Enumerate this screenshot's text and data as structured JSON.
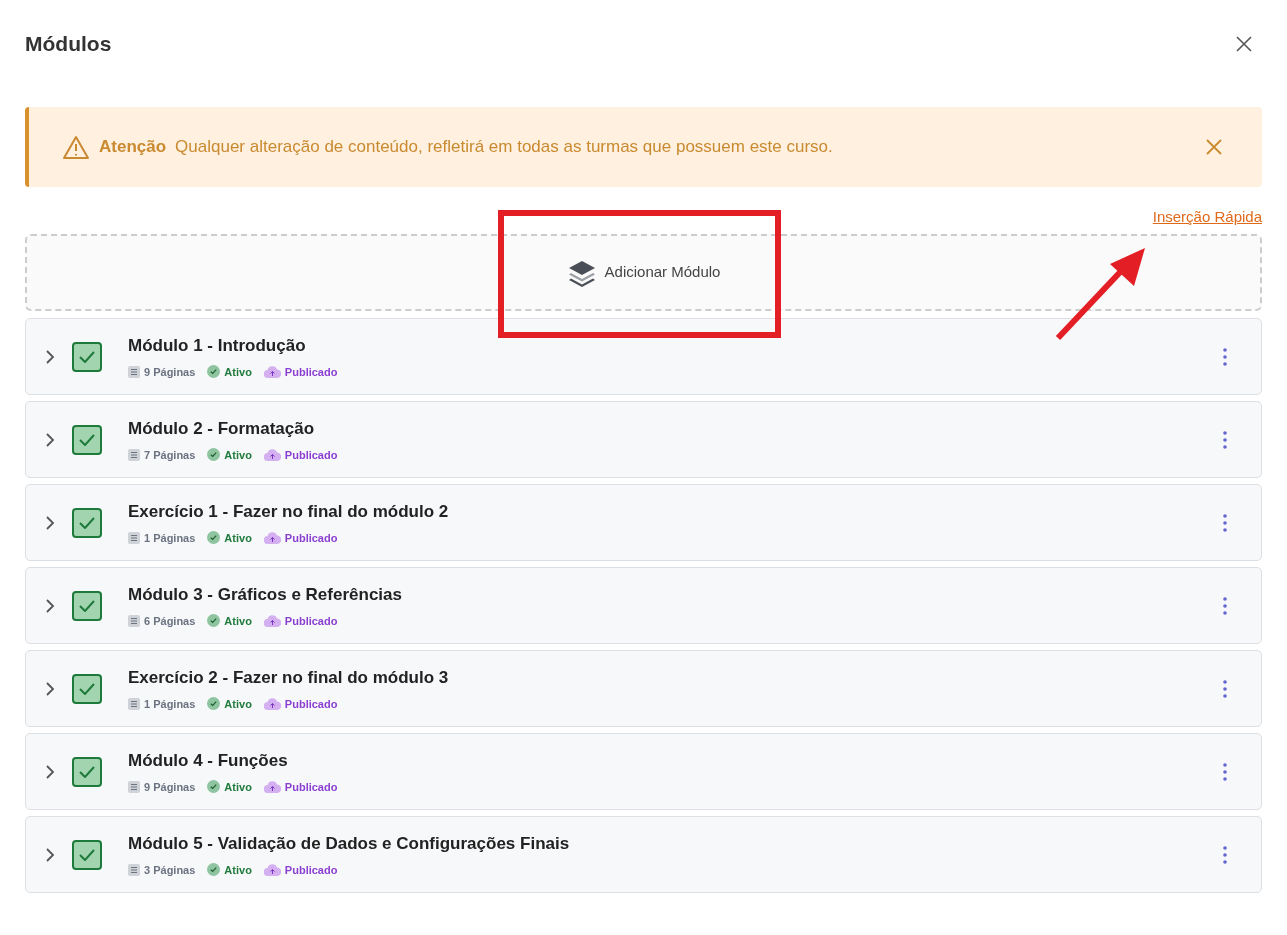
{
  "dialog": {
    "title": "Módulos"
  },
  "alert": {
    "label": "Atenção",
    "message": "Qualquer alteração de conteúdo, refletirá em todas as turmas que possuem este curso."
  },
  "quick_insert_link": "Inserção Rápida",
  "add_module_button": "Adicionar Módulo",
  "modules": [
    {
      "title": "Módulo 1 - Introdução",
      "pages": "9 Páginas",
      "status": "Ativo",
      "publication": "Publicado",
      "checked": true,
      "expanded": false
    },
    {
      "title": "Módulo 2 - Formatação",
      "pages": "7 Páginas",
      "status": "Ativo",
      "publication": "Publicado",
      "checked": true,
      "expanded": false
    },
    {
      "title": "Exercício 1 - Fazer no final do módulo 2",
      "pages": "1 Páginas",
      "status": "Ativo",
      "publication": "Publicado",
      "checked": true,
      "expanded": false
    },
    {
      "title": "Módulo 3 - Gráficos e Referências",
      "pages": "6 Páginas",
      "status": "Ativo",
      "publication": "Publicado",
      "checked": true,
      "expanded": false
    },
    {
      "title": "Exercício 2 - Fazer no final do módulo 3",
      "pages": "1 Páginas",
      "status": "Ativo",
      "publication": "Publicado",
      "checked": true,
      "expanded": false
    },
    {
      "title": "Módulo 4 - Funções",
      "pages": "9 Páginas",
      "status": "Ativo",
      "publication": "Publicado",
      "checked": true,
      "expanded": false
    },
    {
      "title": "Módulo 5 - Validação de Dados e Configurações Finais",
      "pages": "3 Páginas",
      "status": "Ativo",
      "publication": "Publicado",
      "checked": true,
      "expanded": false
    }
  ]
}
